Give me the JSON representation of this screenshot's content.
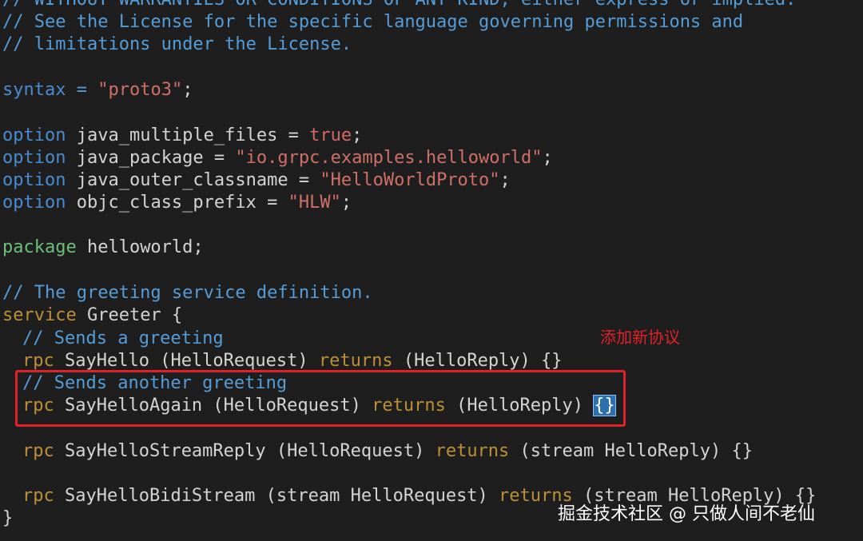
{
  "lines": {
    "l0": "// WITHOUT WARRANTIES OR CONDITIONS OF ANY KIND, either express or implied.",
    "l1": "// See the License for the specific language governing permissions and",
    "l2": "// limitations under the License.",
    "syntax_kw": "syntax",
    "syntax_eq": " = ",
    "syntax_val": "\"proto3\"",
    "syntax_end": ";",
    "opt1_kw": "option",
    "opt1_name": " java_multiple_files = ",
    "opt1_val": "true",
    "opt1_end": ";",
    "opt2_kw": "option",
    "opt2_name": " java_package = ",
    "opt2_val": "\"io.grpc.examples.helloworld\"",
    "opt2_end": ";",
    "opt3_kw": "option",
    "opt3_name": " java_outer_classname = ",
    "opt3_val": "\"HelloWorldProto\"",
    "opt3_end": ";",
    "opt4_kw": "option",
    "opt4_name": " objc_class_prefix = ",
    "opt4_val": "\"HLW\"",
    "opt4_end": ";",
    "pkg_kw": "package",
    "pkg_name": " helloworld;",
    "comment_service": "// The greeting service definition.",
    "service_kw": "service",
    "service_name": " Greeter {",
    "c_sends": "// Sends a greeting",
    "rpc1_kw": "rpc",
    "rpc1_sig": " SayHello (HelloRequest) ",
    "rpc1_ret": "returns",
    "rpc1_tail": " (HelloReply) {}",
    "c_sends_another": "// Sends another greeting",
    "rpc2_kw": "rpc",
    "rpc2_sig": " SayHelloAgain (HelloRequest) ",
    "rpc2_ret": "returns",
    "rpc2_tail": " (HelloReply) ",
    "rpc2_brace": "{}",
    "rpc3_kw": "rpc",
    "rpc3_sig": " SayHelloStreamReply (HelloRequest) ",
    "rpc3_ret": "returns",
    "rpc3_tail": " (stream HelloReply) {}",
    "rpc4_kw": "rpc",
    "rpc4_sig": " SayHelloBidiStream (stream HelloRequest) ",
    "rpc4_ret": "returns",
    "rpc4_tail": " (stream HelloReply) {}",
    "close": "}"
  },
  "annotation": "添加新协议",
  "watermark": "掘金技术社区 @ 只做人间不老仙",
  "colors": {
    "comment": "#569cd6",
    "keyword": "#6a9955",
    "string": "#ce7068",
    "returns": "#bb9038",
    "highlight_box": "#e0232a",
    "background": "#1e1e1e"
  }
}
